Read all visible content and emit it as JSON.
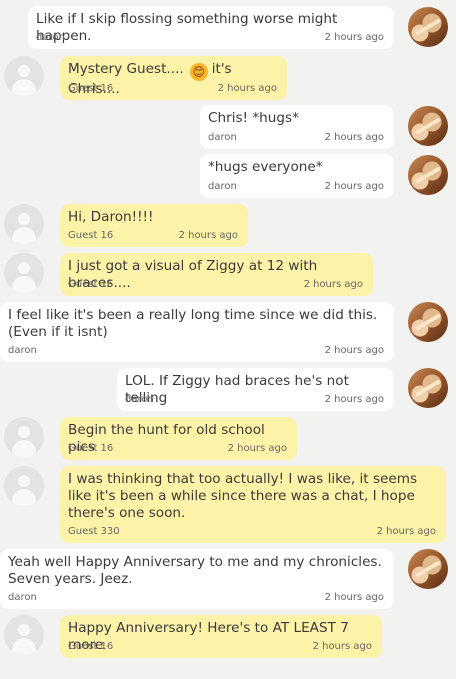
{
  "messages": [
    {
      "kind": "own",
      "text": "Like if I skip flossing something worse might happen.",
      "author": "daron",
      "time": "2 hours ago"
    },
    {
      "kind": "guest",
      "text_before": "Mystery Guest....",
      "emoji": "😊",
      "text_after": "it's Chris....",
      "author": "Guest 16",
      "time": "2 hours ago"
    },
    {
      "kind": "own",
      "text": "Chris! *hugs*",
      "author": "daron",
      "time": "2 hours ago"
    },
    {
      "kind": "own",
      "text": "*hugs everyone*",
      "author": "daron",
      "time": "2 hours ago"
    },
    {
      "kind": "guest",
      "text": "Hi, Daron!!!!",
      "author": "Guest 16",
      "time": "2 hours ago"
    },
    {
      "kind": "guest",
      "text": "I just got a visual of Ziggy at 12 with braces....",
      "author": "Guest 16",
      "time": "2 hours ago"
    },
    {
      "kind": "own",
      "text": "I feel like it's been a really long time since we did this. (Even if it isnt)",
      "author": "daron",
      "time": "2 hours ago"
    },
    {
      "kind": "own",
      "text": "LOL. If Ziggy had braces he's not telling",
      "author": "daron",
      "time": "2 hours ago"
    },
    {
      "kind": "guest",
      "text": "Begin the hunt for old school pics",
      "author": "Guest 16",
      "time": "2 hours ago"
    },
    {
      "kind": "guest",
      "text": "I was thinking that too actually! I was like, it seems like it's been a while since there was a chat, I hope there's one soon.",
      "author": "Guest 330",
      "time": "2 hours ago"
    },
    {
      "kind": "own",
      "text": "Yeah well Happy Anniversary to me and my chronicles. Seven years. Jeez.",
      "author": "daron",
      "time": "2 hours ago"
    },
    {
      "kind": "guest",
      "text": "Happy Anniversary! Here's to AT LEAST 7 more",
      "author": "Guest 16",
      "time": "2 hours ago"
    }
  ],
  "colors": {
    "guest_bubble": "#fdf3a8",
    "own_bubble": "#ffffff",
    "background": "#f2f2f0"
  },
  "icons": {
    "guest_avatar": "default-user-icon",
    "user_avatar": "profile-photo"
  }
}
